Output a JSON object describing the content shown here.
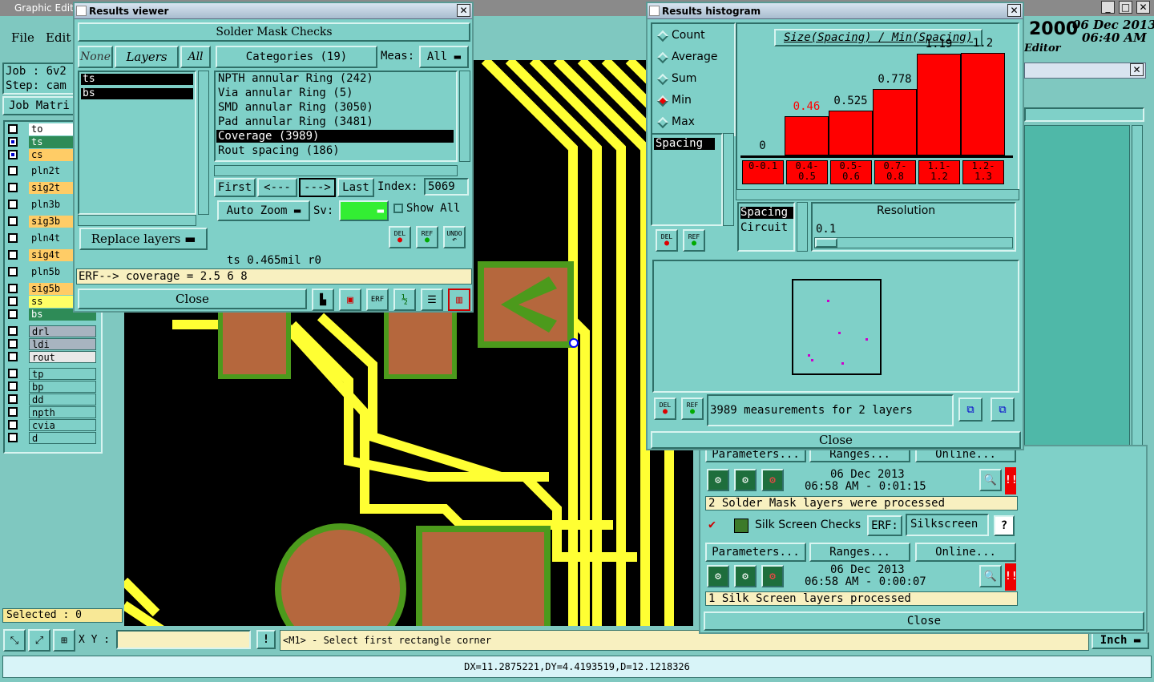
{
  "main": {
    "title": "Graphic Editor",
    "menu": [
      "File",
      "Edit"
    ],
    "job_label": "Job : 6v2",
    "step_label": "Step: cam",
    "job_matrix": "Job Matri",
    "date_year": "2000",
    "date": "06 Dec 2013",
    "time": "06:40 AM",
    "editor": "Editor",
    "selected": "Selected : 0",
    "xy_label": "X Y :",
    "xy_value": "",
    "status_message": "<M1> - Select first rectangle corner",
    "units": "Inch",
    "measure": "DX=11.2875221,DY=4.4193519,D=12.1218326",
    "layers": [
      {
        "name": "to",
        "bg": "#ffffff",
        "sel": false
      },
      {
        "name": "ts",
        "bg": "#2e8b57",
        "sel": true
      },
      {
        "name": "cs",
        "bg": "#ffcc66",
        "sel": true
      },
      {
        "name": "pln2t",
        "bg": "#7fd0c8",
        "sel": false
      },
      {
        "name": "sig2t",
        "bg": "#ffcc66",
        "sel": false
      },
      {
        "name": "pln3b",
        "bg": "#7fd0c8",
        "sel": false
      },
      {
        "name": "sig3b",
        "bg": "#ffcc66",
        "sel": false
      },
      {
        "name": "pln4t",
        "bg": "#7fd0c8",
        "sel": false
      },
      {
        "name": "sig4t",
        "bg": "#ffcc66",
        "sel": false
      },
      {
        "name": "pln5b",
        "bg": "#7fd0c8",
        "sel": false
      },
      {
        "name": "sig5b",
        "bg": "#ffcc66",
        "sel": false
      },
      {
        "name": "ss",
        "bg": "#ffff66",
        "sel": false
      },
      {
        "name": "bs",
        "bg": "#2e8b57",
        "sel": false
      }
    ],
    "layers2": [
      "drl",
      "ldi",
      "rout"
    ],
    "layers3": [
      "tp",
      "bp",
      "dd",
      "npth",
      "cvia",
      "d"
    ]
  },
  "results_viewer": {
    "title": "Results viewer",
    "header": "Solder Mask Checks",
    "none": "None",
    "layers": "Layers",
    "all": "All",
    "categories_label": "Categories (19)",
    "meas_label": "Meas:",
    "meas_value": "All",
    "layer_list": [
      "ts",
      "bs"
    ],
    "categories": [
      "NPTH annular Ring (242)",
      "Via annular Ring (5)",
      "SMD annular Ring (3050)",
      "Pad annular Ring (3481)",
      "Coverage (3989)",
      "Rout spacing (186)"
    ],
    "selected_category": 4,
    "first": "First",
    "prev": "<---",
    "next": "--->",
    "last": "Last",
    "index_label": "Index:",
    "index_value": "5069",
    "auto_zoom": "Auto Zoom",
    "sv_label": "Sv:",
    "show_all": "Show All",
    "replace_layers": "Replace layers",
    "del": "DEL",
    "ref": "REF",
    "undo": "UNDO",
    "status1": "ts 0.465mil  r0",
    "status2": "ERF--> coverage = 2.5 6 8",
    "close": "Close"
  },
  "histogram": {
    "title": "Results histogram",
    "options": [
      "Count",
      "Average",
      "Sum",
      "Min",
      "Max"
    ],
    "selected_option": 3,
    "list_item": "Spacing",
    "chart_title": "Size(Spacing) / Min(Spacing)",
    "mode1": "Spacing",
    "mode2": "Circuit",
    "resolution_label": "Resolution",
    "resolution_value": "0.1",
    "del": "DEL",
    "ref": "REF",
    "summary": "3989 measurements for 2 layers",
    "close": "Close"
  },
  "chart_data": {
    "type": "bar",
    "title": "Size(Spacing) / Min(Spacing)",
    "categories": [
      "0-0.1",
      "0.4-0.5",
      "0.5-0.6",
      "0.7-0.8",
      "1.1-1.2",
      "1.2-1.3"
    ],
    "values": [
      0,
      0.46,
      0.525,
      0.778,
      1.19,
      1.2
    ],
    "value_labels": [
      "0",
      "0.46",
      "0.525",
      "0.778",
      "1.19",
      "1.2"
    ],
    "ylim": [
      0,
      1.2
    ],
    "color": "#ff0000",
    "highlight_label_color": "#ff0000",
    "grid": false
  },
  "checks": {
    "parameters": "Parameters...",
    "ranges": "Ranges...",
    "online": "Online...",
    "sm_date": "06 Dec 2013",
    "sm_time": "06:58 AM - 0:01:15",
    "sm_status": "2 Solder Mask layers were processed",
    "ss_name": "Silk Screen Checks",
    "erf_label": "ERF:",
    "erf_value": "Silkscreen",
    "help": "?",
    "ss_date": "06 Dec 2013",
    "ss_time": "06:58 AM - 0:00:07",
    "ss_status": "1 Silk Screen layers processed",
    "close": "Close"
  }
}
